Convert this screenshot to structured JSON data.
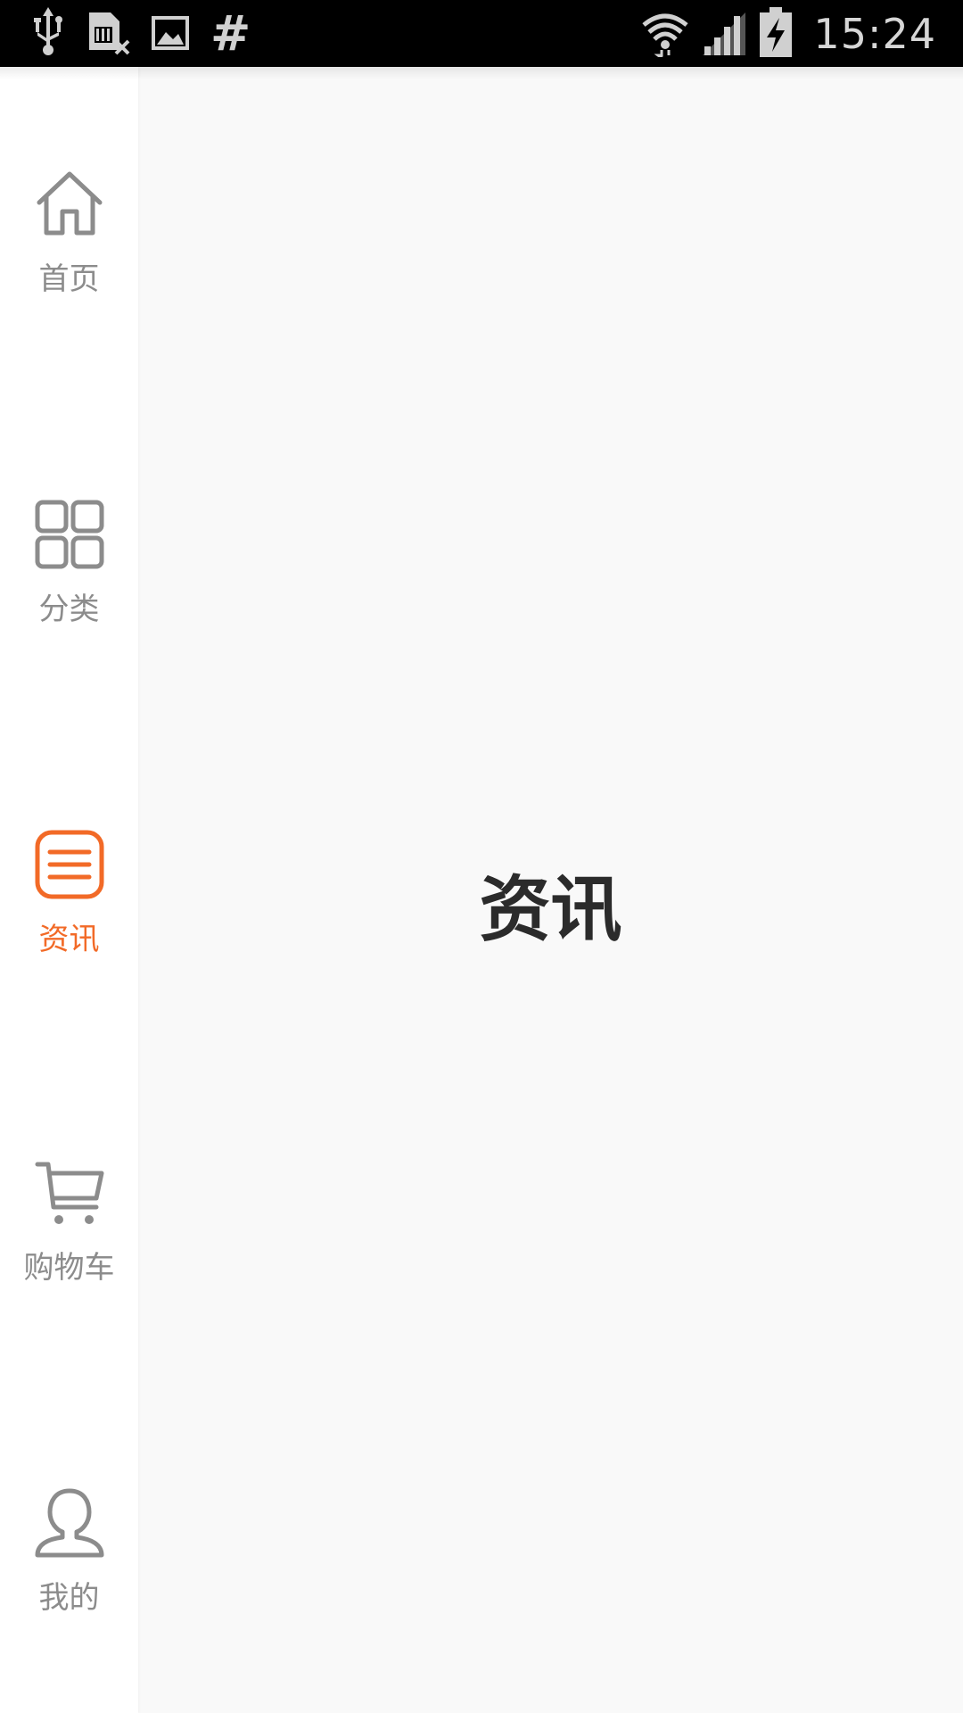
{
  "status_bar": {
    "time": "15:24",
    "left_icons": [
      "usb-icon",
      "sim-card-missing-icon",
      "image-icon",
      "hash-icon"
    ],
    "right_icons": [
      "wifi-icon",
      "signal-icon",
      "battery-charging-icon"
    ]
  },
  "sidebar": {
    "items": [
      {
        "label": "首页",
        "icon": "home-icon",
        "active": false
      },
      {
        "label": "分类",
        "icon": "grid-icon",
        "active": false
      },
      {
        "label": "资讯",
        "icon": "news-list-icon",
        "active": true
      },
      {
        "label": "购物车",
        "icon": "cart-icon",
        "active": false
      },
      {
        "label": "我的",
        "icon": "user-icon",
        "active": false
      }
    ]
  },
  "main": {
    "title": "资讯"
  },
  "colors": {
    "accent": "#f26a27",
    "inactive": "#8c8c8c",
    "background": "#f9f9f9",
    "sidebar_bg": "#ffffff",
    "status_bar_bg": "#000000"
  }
}
